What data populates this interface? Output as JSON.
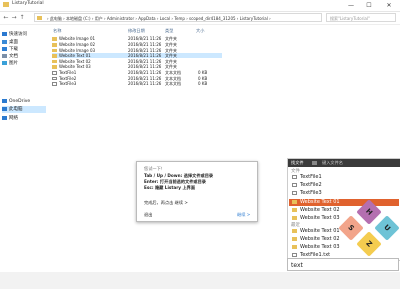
{
  "window": {
    "title": "ListaryTutorial",
    "controls": [
      "—",
      "☐",
      "✕"
    ]
  },
  "addressbar": {
    "path": "›  此电脑  ›  本地磁盘 (C:)  ›  用户  ›  Administrator  ›  AppData  ›  Local  ›  Temp  ›  scoped_dir4184_31205  ›  ListaryTutorial  ›",
    "search_placeholder": "搜索\"ListaryTutorial\""
  },
  "sidebar": {
    "items": [
      {
        "label": "快速访问",
        "icon": "star-icon",
        "color": "#2b79d0"
      },
      {
        "label": "桌面",
        "icon": "desktop-icon",
        "color": "#3a8ad6"
      },
      {
        "label": "下载",
        "icon": "download-icon",
        "color": "#2e7fd4"
      },
      {
        "label": "文档",
        "icon": "document-icon",
        "color": "#7a8fa8"
      },
      {
        "label": "图片",
        "icon": "picture-icon",
        "color": "#3aa0d8"
      },
      {
        "label": "OneDrive",
        "icon": "cloud-icon",
        "color": "#2a7ad0"
      },
      {
        "label": "此电脑",
        "icon": "computer-icon",
        "color": "#2a7ad0"
      },
      {
        "label": "网络",
        "icon": "network-icon",
        "color": "#2a7ad0"
      }
    ]
  },
  "columns": {
    "name": "名称",
    "date": "修改日期",
    "type": "类型",
    "size": "大小"
  },
  "files": [
    {
      "name": "Website Image 01",
      "date": "2016/8/21 11:26",
      "type": "文件夹",
      "size": "",
      "kind": "folder"
    },
    {
      "name": "Website Image 02",
      "date": "2016/8/21 11:26",
      "type": "文件夹",
      "size": "",
      "kind": "folder"
    },
    {
      "name": "Website Image 03",
      "date": "2016/8/21 11:26",
      "type": "文件夹",
      "size": "",
      "kind": "folder"
    },
    {
      "name": "Website Text 01",
      "date": "2016/8/21 11:26",
      "type": "文件夹",
      "size": "",
      "kind": "folder",
      "selected": true
    },
    {
      "name": "Website Text 02",
      "date": "2016/8/21 11:26",
      "type": "文件夹",
      "size": "",
      "kind": "folder"
    },
    {
      "name": "Website Text 03",
      "date": "2016/8/21 11:26",
      "type": "文件夹",
      "size": "",
      "kind": "folder"
    },
    {
      "name": "TextFile1",
      "date": "2016/8/21 11:26",
      "type": "文本文档",
      "size": "0 KB",
      "kind": "file"
    },
    {
      "name": "TextFile2",
      "date": "2016/8/21 11:26",
      "type": "文本文档",
      "size": "0 KB",
      "kind": "file"
    },
    {
      "name": "TextFile3",
      "date": "2016/8/21 11:26",
      "type": "文本文档",
      "size": "0 KB",
      "kind": "file"
    }
  ],
  "tooltip": {
    "title": "您试一下！",
    "line1": "Tab / Up / Down: 选择文件或目录",
    "line2": "Enter: 打开当前选的文件或目录",
    "line3": "Esc: 隐藏 Listary 上界面",
    "hint": "完成后，再点击 继续 >",
    "back": "退出",
    "next": "继续 >"
  },
  "listary": {
    "header_label": "找文件",
    "header_input": "键入文件名",
    "section_files": "文件",
    "section_recent": "最近",
    "input_value": "text",
    "items": [
      {
        "label": "TextFile1",
        "kind": "file"
      },
      {
        "label": "TextFile2",
        "kind": "file"
      },
      {
        "label": "TextFile3",
        "kind": "file"
      },
      {
        "label": "Website Text 01",
        "kind": "folder",
        "selected": true
      },
      {
        "label": "Website Text 02",
        "kind": "folder"
      },
      {
        "label": "Website Text 03",
        "kind": "folder"
      },
      {
        "label": "Website Text 01",
        "kind": "folder"
      },
      {
        "label": "Website Text 02",
        "kind": "folder"
      },
      {
        "label": "Website Text 03",
        "kind": "folder"
      },
      {
        "label": "TextFile1.txt",
        "kind": "file"
      }
    ]
  },
  "logo": {
    "tiles": [
      {
        "letter": "S",
        "color": "#f2a48a"
      },
      {
        "letter": "Z",
        "color": "#f4cc4f"
      },
      {
        "letter": "H",
        "color": "#b46fb0"
      },
      {
        "letter": "U",
        "color": "#6ec3d6"
      }
    ]
  }
}
